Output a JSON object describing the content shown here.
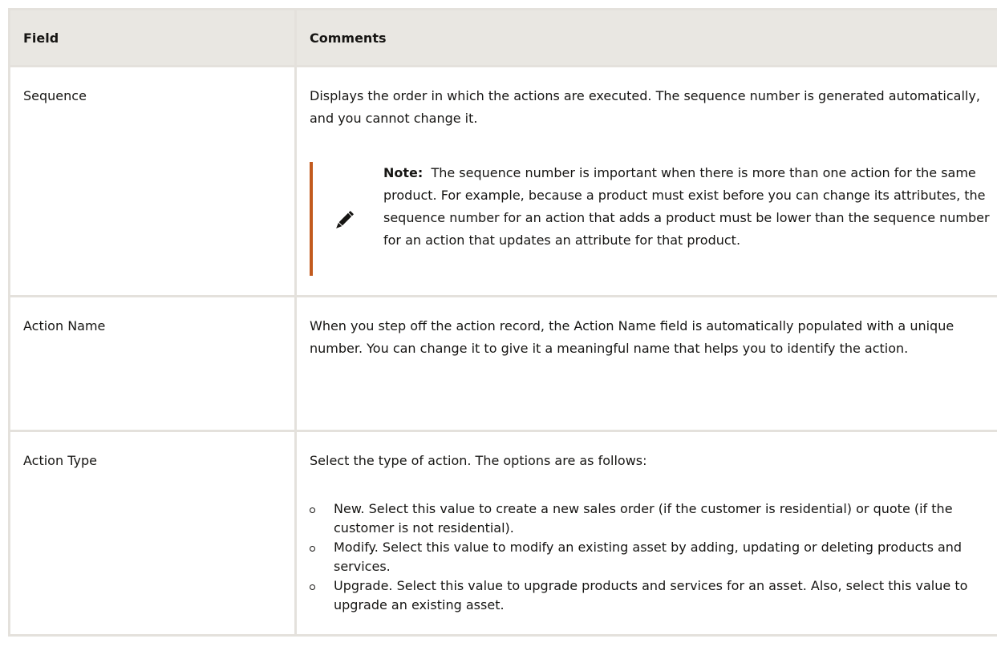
{
  "table": {
    "headers": {
      "field": "Field",
      "comments": "Comments"
    },
    "rows": [
      {
        "field": "Sequence",
        "text": "Displays the order in which the actions are executed. The sequence number is generated automatically, and you cannot change it.",
        "note": {
          "icon": "pencil-icon",
          "label": "Note:",
          "text": "The sequence number is important when there is more than one action for the same product. For example, because a product must exist before you can change its attributes, the sequence number for an action that adds a product must be lower than the sequence number for an action that updates an attribute for that product."
        }
      },
      {
        "field": "Action Name",
        "text": "When you step off the action record, the Action Name field is automatically populated with a unique number. You can change it to give it a meaningful name that helps you to identify the action."
      },
      {
        "field": "Action Type",
        "text": "Select the type of action. The options are as follows:",
        "options": [
          "New. Select this value to create a new sales order (if the customer is residential) or quote (if the customer is not residential).",
          "Modify. Select this value to modify an existing asset by adding, updating or deleting products and services.",
          "Upgrade. Select this value to upgrade products and services for an asset. Also, select this value to upgrade an existing asset."
        ]
      }
    ]
  },
  "colors": {
    "header_bg": "#e9e7e2",
    "border": "#e4e1dc",
    "note_accent": "#c25a1e",
    "text": "#161513"
  }
}
